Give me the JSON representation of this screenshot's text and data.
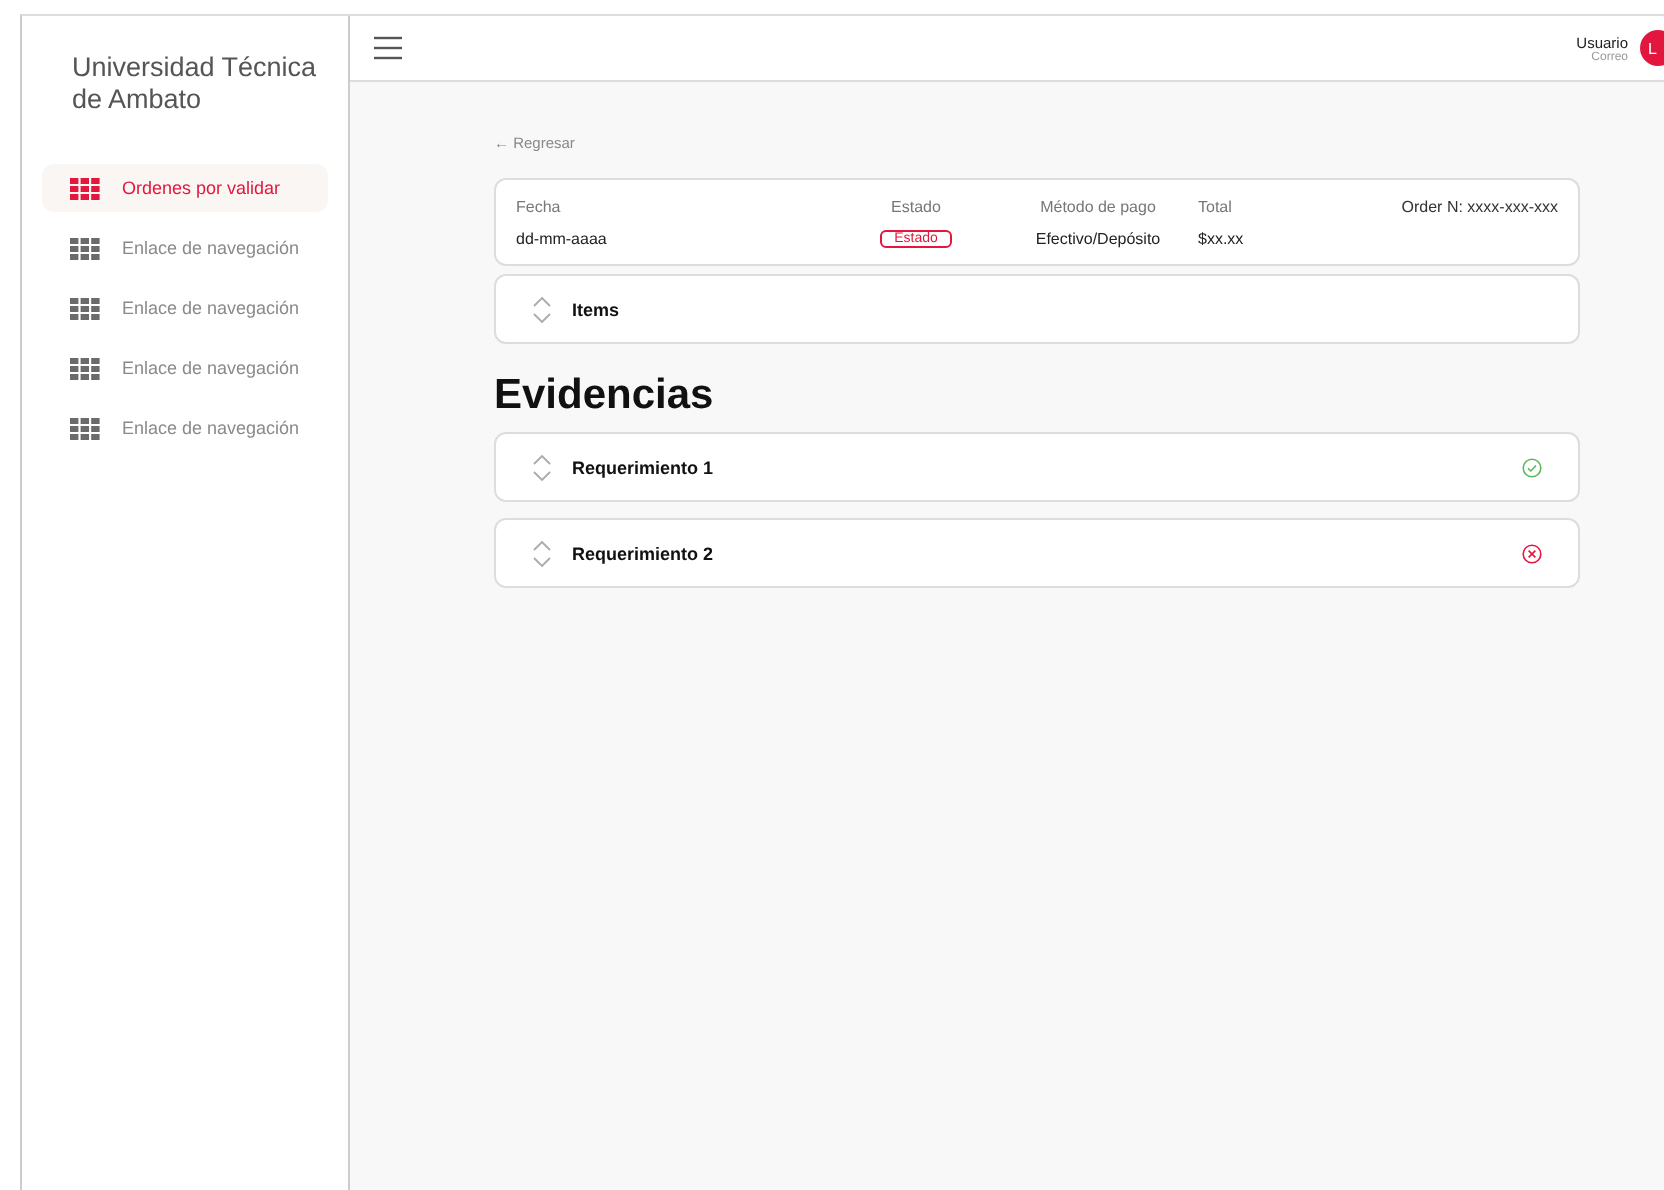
{
  "sidebar": {
    "title": "Universidad Técnica de Ambato",
    "items": [
      {
        "label": "Ordenes por validar",
        "selected": true
      },
      {
        "label": "Enlace de navegación",
        "selected": false
      },
      {
        "label": "Enlace de navegación",
        "selected": false
      },
      {
        "label": "Enlace de navegación",
        "selected": false
      },
      {
        "label": "Enlace de navegación",
        "selected": false
      }
    ]
  },
  "user": {
    "name": "Usuario",
    "email": "Correo",
    "initials": "L"
  },
  "back_link": "← Regresar",
  "order": {
    "columns": [
      {
        "label": "Fecha",
        "value": "dd-mm-aaaa",
        "kind": "text"
      },
      {
        "label": "Estado",
        "value": "Estado",
        "kind": "badge"
      },
      {
        "label": "Método de pago",
        "value": "Efectivo/Depósito",
        "kind": "text"
      },
      {
        "label": "Total",
        "value": "$xx.xx",
        "kind": "text"
      }
    ],
    "order_number": "Order N: xxxx-xxx-xxx"
  },
  "items_section": {
    "title": "Items",
    "expanded": false
  },
  "evidence_title": "Evidencias",
  "requirements": [
    {
      "title": "Requerimiento 1",
      "expanded": false,
      "kind": "approved"
    },
    {
      "title": "Requerimiento 2",
      "expanded": false,
      "kind": "rejected"
    }
  ]
}
